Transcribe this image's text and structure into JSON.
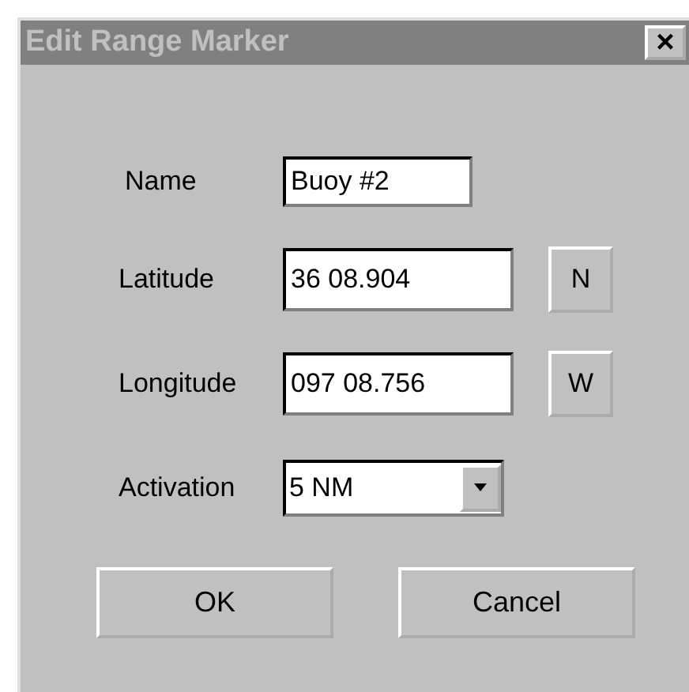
{
  "window": {
    "title": "Edit Range Marker",
    "close": "×"
  },
  "fields": [
    {
      "kind": "text",
      "label": "Name",
      "value": "Buoy #2"
    },
    {
      "kind": "text",
      "label": "Latitude",
      "value": "36 08.904",
      "button": "N"
    },
    {
      "kind": "text",
      "label": "Longitude",
      "value": "097 08.756",
      "button": "W"
    },
    {
      "kind": "combo",
      "label": "Activation",
      "value": "5 NM"
    }
  ],
  "buttons": [
    "OK",
    "Cancel"
  ]
}
